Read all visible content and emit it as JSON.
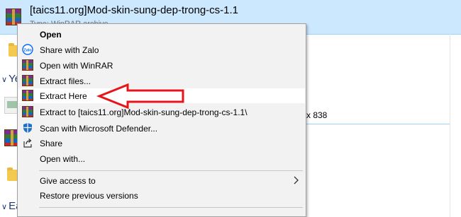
{
  "file": {
    "name": "[taics11.org]Mod-skin-sung-dep-trong-cs-1.1",
    "type": "Type: WinRAR archive"
  },
  "groups": {
    "yesterday_prefix": "Ye",
    "earlier_prefix": "Ea"
  },
  "partial_text": {
    "dimensions": "x 838"
  },
  "context_menu": {
    "items": [
      {
        "label": "Open",
        "icon": "none",
        "bold": true
      },
      {
        "label": "Share with Zalo",
        "icon": "zalo-icon"
      },
      {
        "label": "Open with WinRAR",
        "icon": "winrar-icon"
      },
      {
        "label": "Extract files...",
        "icon": "winrar-icon"
      },
      {
        "label": "Extract Here",
        "icon": "winrar-icon",
        "highlighted": true
      },
      {
        "label": "Extract to [taics11.org]Mod-skin-sung-dep-trong-cs-1.1\\",
        "icon": "winrar-icon"
      },
      {
        "label": "Scan with Microsoft Defender...",
        "icon": "defender-shield-icon"
      },
      {
        "label": "Share",
        "icon": "share-icon"
      },
      {
        "label": "Open with...",
        "icon": "none"
      },
      {
        "label": "Give access to",
        "icon": "none",
        "submenu": true
      },
      {
        "label": "Restore previous versions",
        "icon": "none"
      }
    ]
  },
  "colors": {
    "selection": "#cce8ff",
    "menu_background": "#f2f2f2",
    "highlight": "#ffffff",
    "annotation_arrow": "#e8141b"
  }
}
